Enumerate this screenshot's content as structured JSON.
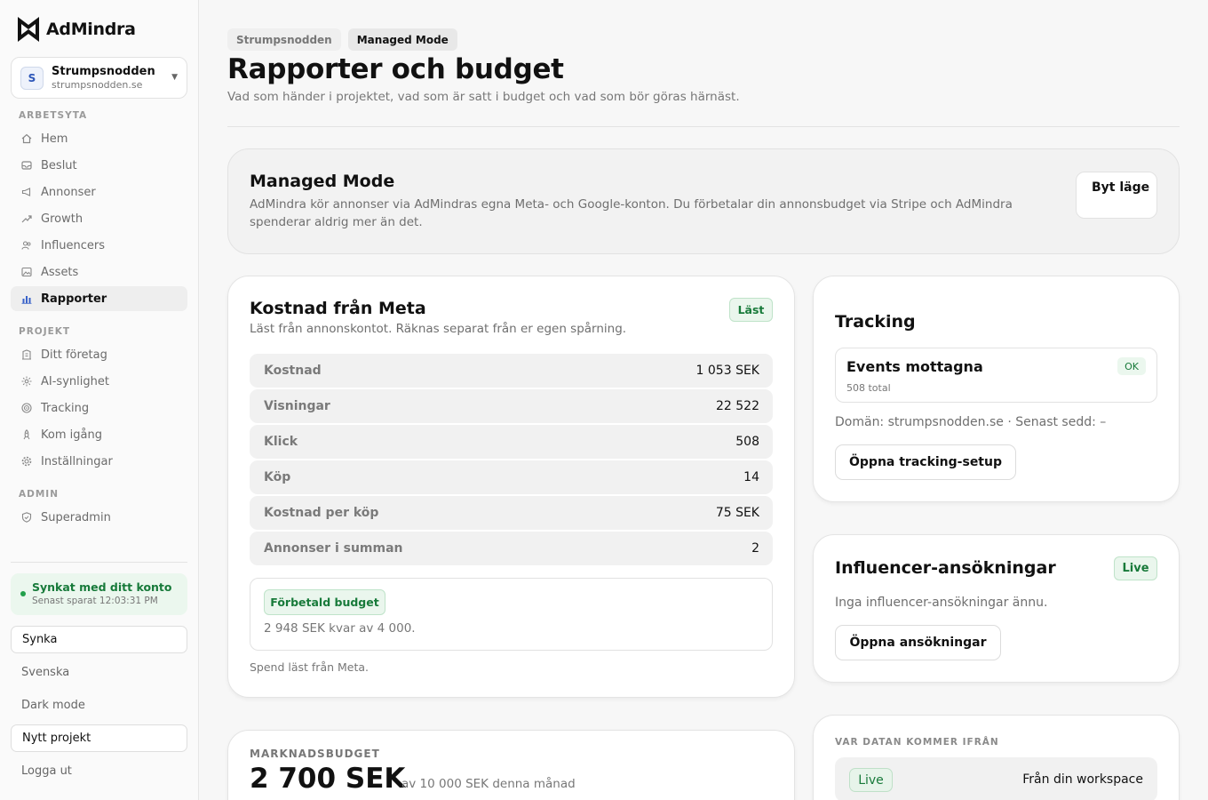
{
  "brand": {
    "name": "AdMindra"
  },
  "workspace": {
    "initial": "S",
    "name": "Strumpsnodden",
    "domain": "strumpsnodden.se"
  },
  "sidebar": {
    "sections": {
      "workspace": "ARBETSYTA",
      "project": "PROJEKT",
      "admin": "ADMIN"
    },
    "workspace_items": [
      {
        "label": "Hem",
        "icon": "home-icon"
      },
      {
        "label": "Beslut",
        "icon": "inbox-icon"
      },
      {
        "label": "Annonser",
        "icon": "megaphone-icon"
      },
      {
        "label": "Growth",
        "icon": "trend-up-icon"
      },
      {
        "label": "Influencers",
        "icon": "users-icon"
      },
      {
        "label": "Assets",
        "icon": "image-icon"
      },
      {
        "label": "Rapporter",
        "icon": "bar-chart-icon",
        "active": true
      }
    ],
    "project_items": [
      {
        "label": "Ditt företag",
        "icon": "building-icon"
      },
      {
        "label": "AI-synlighet",
        "icon": "sparkle-icon"
      },
      {
        "label": "Tracking",
        "icon": "target-icon"
      },
      {
        "label": "Kom igång",
        "icon": "rocket-icon"
      },
      {
        "label": "Inställningar",
        "icon": "gear-icon"
      }
    ],
    "admin_items": [
      {
        "label": "Superadmin",
        "icon": "shield-icon"
      }
    ],
    "sync": {
      "title": "Synkat med ditt konto",
      "subtitle": "Senast sparat 12:03:31 PM"
    },
    "sync_button": "Synka",
    "language": "Svenska",
    "dark_mode": "Dark mode",
    "new_project": "Nytt projekt",
    "logout": "Logga ut"
  },
  "breadcrumbs": [
    "Strumpsnodden",
    "Managed Mode"
  ],
  "page": {
    "title": "Rapporter och budget",
    "subtitle": "Vad som händer i projektet, vad som är satt i budget och vad som bör göras härnäst."
  },
  "managed_mode": {
    "title": "Managed Mode",
    "description": "AdMindra kör annonser via AdMindras egna Meta- och Google-konton. Du förbetalar din annonsbudget via Stripe och AdMindra spenderar aldrig mer än det.",
    "switch_button": "Byt läge"
  },
  "meta_cost": {
    "title": "Kostnad från Meta",
    "subtitle": "Läst från annonskontot. Räknas separat från er egen spårning.",
    "badge": "Läst",
    "rows": [
      {
        "label": "Kostnad",
        "value": "1 053 SEK"
      },
      {
        "label": "Visningar",
        "value": "22 522"
      },
      {
        "label": "Klick",
        "value": "508"
      },
      {
        "label": "Köp",
        "value": "14"
      },
      {
        "label": "Kostnad per köp",
        "value": "75 SEK"
      },
      {
        "label": "Annonser i summan",
        "value": "2"
      }
    ],
    "budget_tag": "Förbetald budget",
    "budget_text": "2 948 SEK kvar av 4 000.",
    "note": "Spend läst från Meta."
  },
  "tracking": {
    "title": "Tracking",
    "events_title": "Events mottagna",
    "events_badge": "OK",
    "events_total": "508 total",
    "domain_line": "Domän: strumpsnodden.se · Senast sedd: –",
    "button": "Öppna tracking-setup"
  },
  "influencer": {
    "title": "Influencer-ansökningar",
    "badge": "Live",
    "empty": "Inga influencer-ansökningar ännu.",
    "button": "Öppna ansökningar"
  },
  "data_source": {
    "label": "VAR DATAN KOMMER IFRÅN",
    "badge": "Live",
    "text": "Från din workspace"
  },
  "marketing_budget": {
    "label": "MARKNADSBUDGET",
    "value": "2 700 SEK",
    "suffix": "av 10 000 SEK denna månad"
  },
  "colors": {
    "accent_green": "#187a3a",
    "active_bg": "#eeeeee",
    "brand": "#111111"
  }
}
